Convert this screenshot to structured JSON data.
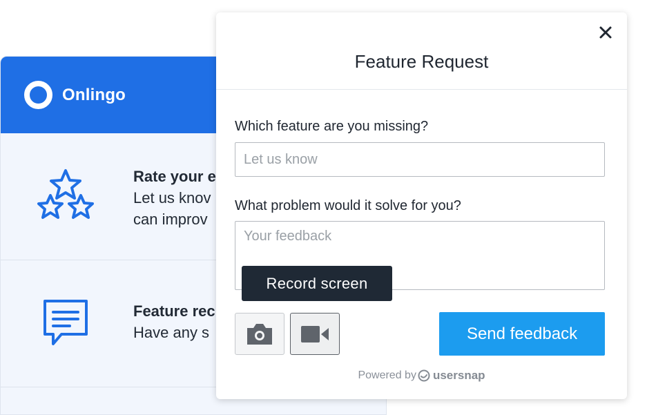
{
  "app": {
    "brand_name": "Onlingo",
    "brand_color": "#1f6fe5",
    "items": [
      {
        "icon": "stars-icon",
        "title": "Rate your e",
        "lines": [
          "Let us knov",
          "can improv"
        ]
      },
      {
        "icon": "chat-icon",
        "title": "Feature rec",
        "lines": [
          "Have any s"
        ]
      }
    ]
  },
  "modal": {
    "title": "Feature Request",
    "close_icon": "close-icon",
    "fields": [
      {
        "label": "Which feature are you missing?",
        "placeholder": "Let us know",
        "value": ""
      },
      {
        "label": "What problem would it solve for you?",
        "placeholder": "Your feedback",
        "value": ""
      }
    ],
    "tooltip": "Record screen",
    "screenshot_icon": "camera-icon",
    "record_icon": "video-camera-icon",
    "send_label": "Send feedback",
    "send_color": "#1c9cef",
    "powered_by": "Powered by",
    "powered_brand": "usersnap",
    "powered_logo": "usersnap-logo-icon"
  }
}
